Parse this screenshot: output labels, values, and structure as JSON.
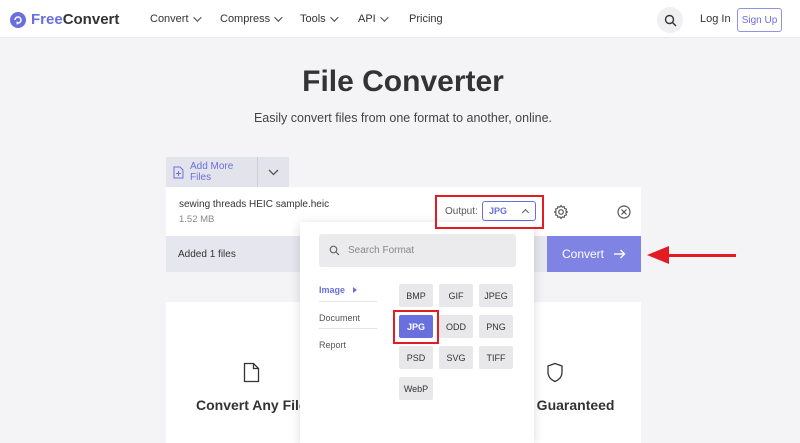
{
  "header": {
    "logo_free": "Free",
    "logo_convert": "Convert",
    "nav": [
      {
        "label": "Convert"
      },
      {
        "label": "Compress"
      },
      {
        "label": "Tools"
      },
      {
        "label": "API"
      },
      {
        "label": "Pricing"
      }
    ],
    "login": "Log In",
    "signup": "Sign Up"
  },
  "hero": {
    "title": "File Converter",
    "subtitle": "Easily convert files from one format to another, online."
  },
  "converter": {
    "add_more": "Add More Files",
    "file_name": "sewing threads HEIC sample.heic",
    "file_size": "1.52 MB",
    "output_label": "Output:",
    "output_value": "JPG",
    "added_text": "Added 1 files",
    "convert_label": "Convert"
  },
  "dropdown": {
    "search_placeholder": "Search Format",
    "categories": [
      {
        "label": "Image",
        "active": true
      },
      {
        "label": "Document",
        "active": false
      },
      {
        "label": "Report",
        "active": false
      }
    ],
    "formats": [
      "BMP",
      "GIF",
      "JPEG",
      "JPG",
      "ODD",
      "PNG",
      "PSD",
      "SVG",
      "TIFF",
      "WebP"
    ],
    "selected": "JPG"
  },
  "features": {
    "left_title": "Convert Any Files",
    "right_title": "y Guaranteed"
  },
  "colors": {
    "accent": "#6a6fde",
    "annotation_red": "#e31b23"
  }
}
